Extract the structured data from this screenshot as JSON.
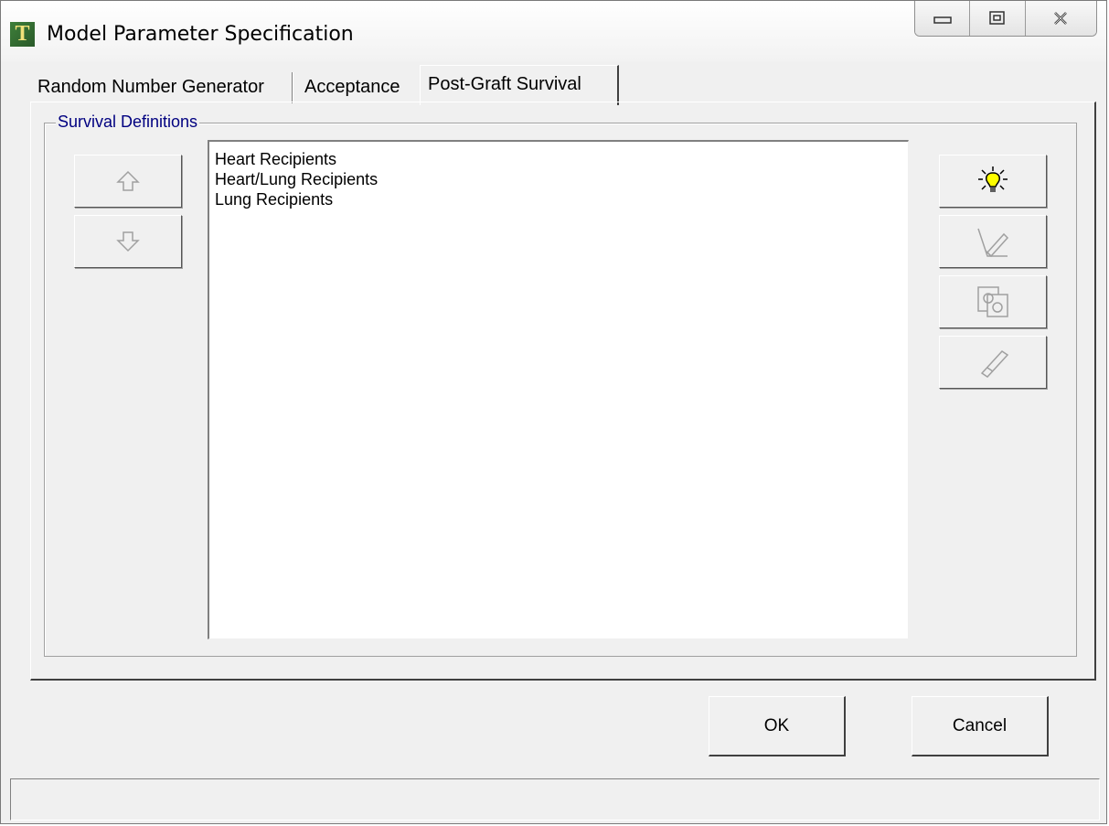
{
  "window": {
    "title": "Model Parameter Specification",
    "app_icon_letter": "T",
    "controls": {
      "minimize_icon": "minimize-icon",
      "maximize_icon": "restore-icon",
      "close_icon": "close-icon"
    }
  },
  "tabs": [
    {
      "label": "Random Number Generator",
      "active": false
    },
    {
      "label": "Acceptance",
      "active": false
    },
    {
      "label": "Post-Graft Survival",
      "active": true
    }
  ],
  "group": {
    "legend": "Survival Definitions",
    "items": [
      "Heart Recipients",
      "Heart/Lung Recipients",
      "Lung Recipients"
    ]
  },
  "left_buttons": [
    {
      "icon": "arrow-up-icon",
      "enabled": false
    },
    {
      "icon": "arrow-down-icon",
      "enabled": false
    }
  ],
  "right_buttons": [
    {
      "icon": "lightbulb-icon",
      "enabled": true
    },
    {
      "icon": "edit-pencil-icon",
      "enabled": false
    },
    {
      "icon": "copy-gears-icon",
      "enabled": false
    },
    {
      "icon": "delete-icon",
      "enabled": false
    }
  ],
  "footer": {
    "ok_label": "OK",
    "cancel_label": "Cancel"
  },
  "colors": {
    "legend_text": "#000080",
    "lightbulb": "#ffff00"
  }
}
